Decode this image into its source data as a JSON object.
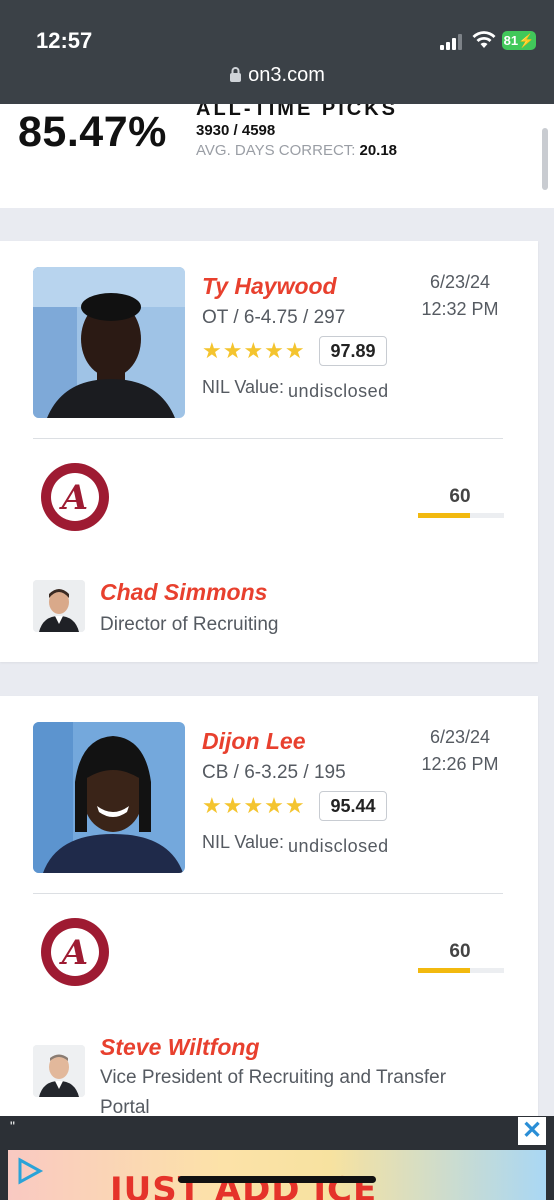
{
  "status_bar": {
    "time": "12:57",
    "battery": "81"
  },
  "browser": {
    "url": "on3.com"
  },
  "stats": {
    "percent": "85.47%",
    "title": "ALL-TIME PICKS",
    "count": "3930 / 4598",
    "avg_label": "AVG. DAYS CORRECT:",
    "avg_value": "20.18"
  },
  "predictions": [
    {
      "name": "Ty Haywood",
      "meta": "OT / 6-4.75 / 297",
      "stars": "★★★★★",
      "star_count": 5,
      "rating": "97.89",
      "nil_label": "NIL Value:",
      "nil_value": "undisclosed",
      "date": "6/23/24",
      "time": "12:32 PM",
      "school_score": "60",
      "score_fill": 0.6,
      "expert_name": "Chad Simmons",
      "expert_title": "Director of Recruiting"
    },
    {
      "name": "Dijon Lee",
      "meta": "CB / 6-3.25 / 195",
      "stars": "★★★★★",
      "star_count": 5,
      "rating": "95.44",
      "nil_label": "NIL Value:",
      "nil_value": "undisclosed",
      "date": "6/23/24",
      "time": "12:26 PM",
      "school_score": "60",
      "score_fill": 0.6,
      "expert_name": "Steve Wiltfong",
      "expert_title": "Vice President of Recruiting and Transfer Portal"
    }
  ],
  "ad": {
    "quote": "\"",
    "close": "✕",
    "headline": "JUST ADD ICE"
  },
  "colors": {
    "accent": "#e8402e",
    "star": "#f4c42e",
    "score_bar": "#f2b90f",
    "crimson": "#9e1b32"
  }
}
